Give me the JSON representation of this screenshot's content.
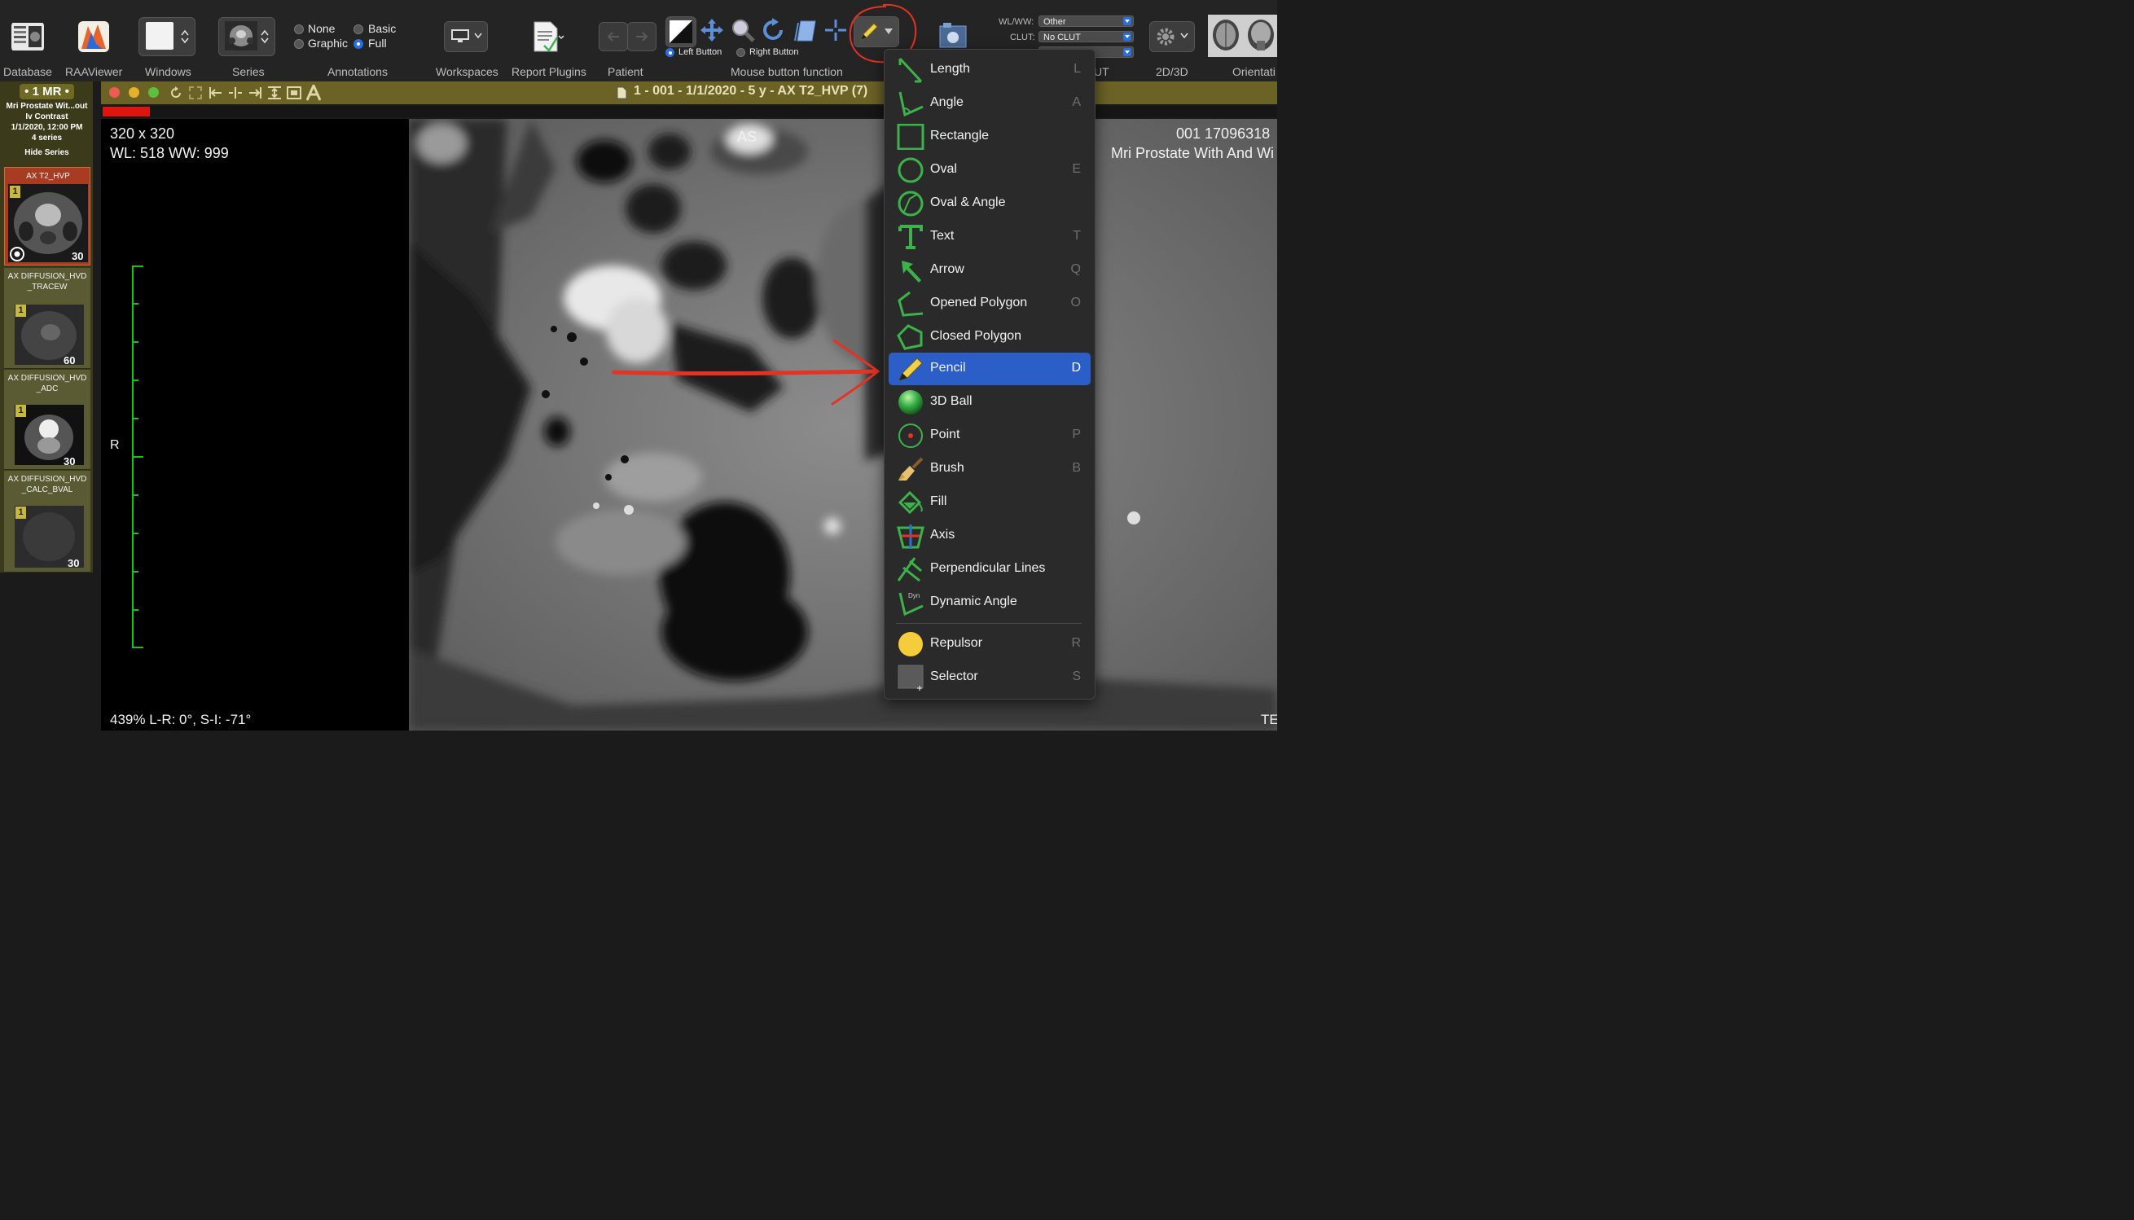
{
  "toolbar": {
    "labels": {
      "database": "Database",
      "raaviewer": "RAAViewer",
      "windows": "Windows",
      "series": "Series",
      "annotations": "Annotations",
      "workspaces": "Workspaces",
      "report_plugins": "Report Plugins",
      "patient": "Patient",
      "mouse_button_function": "Mouse button function",
      "lut_partial": "UT",
      "two_d_three_d": "2D/3D",
      "orientation_partial": "Orientati"
    },
    "annotations": {
      "none": "None",
      "basic": "Basic",
      "graphic": "Graphic",
      "full": "Full",
      "selected": "Full"
    },
    "mouse_buttons": {
      "left": "Left Button",
      "right": "Right Button",
      "selected": "Left Button"
    },
    "wlww": {
      "label": "WL/WW:",
      "value": "Other"
    },
    "clut": {
      "label": "CLUT:",
      "value": "No CLUT"
    }
  },
  "series_panel": {
    "study_label": "• 1 MR •",
    "study_name": "Mri Prostate Wit...out Iv Contrast",
    "study_date": "1/1/2020, 12:00 PM",
    "series_count": "4 series",
    "hide_series": "Hide Series",
    "series": [
      {
        "name": "AX T2_HVP",
        "badge": "1",
        "count": "30"
      },
      {
        "name": "AX DIFFUSION_HVD_TRACEW",
        "badge": "1",
        "count": "60"
      },
      {
        "name": "AX DIFFUSION_HVD_ADC",
        "badge": "1",
        "count": "30"
      },
      {
        "name": "AX DIFFUSION_HVD_CALC_BVAL",
        "badge": "1",
        "count": "30"
      }
    ]
  },
  "viewer": {
    "title": "1 - 001 - 1/1/2020 - 5 y - AX T2_HVP (7)",
    "matrix": "320 x 320",
    "wl_ww": "WL: 518 WW: 999",
    "orientation_top": "AS",
    "orientation_left": "R",
    "patient_id": "001 17096318",
    "study_desc": "Mri Prostate With And Wi",
    "zoom_info": "439% L-R: 0°, S-I: -71°",
    "bottom_right": "TE",
    "progress": 0.04
  },
  "tool_menu": {
    "items": [
      {
        "label": "Length",
        "key": "L",
        "icon": "length-icon"
      },
      {
        "label": "Angle",
        "key": "A",
        "icon": "angle-icon"
      },
      {
        "label": "Rectangle",
        "key": "",
        "icon": "rectangle-icon"
      },
      {
        "label": "Oval",
        "key": "E",
        "icon": "oval-icon"
      },
      {
        "label": "Oval & Angle",
        "key": "",
        "icon": "oval-angle-icon"
      },
      {
        "label": "Text",
        "key": "T",
        "icon": "text-icon"
      },
      {
        "label": "Arrow",
        "key": "Q",
        "icon": "arrow-icon"
      },
      {
        "label": "Opened Polygon",
        "key": "O",
        "icon": "opened-polygon-icon"
      },
      {
        "label": "Closed Polygon",
        "key": "",
        "icon": "closed-polygon-icon"
      },
      {
        "label": "Pencil",
        "key": "D",
        "icon": "pencil-icon"
      },
      {
        "label": "3D Ball",
        "key": "",
        "icon": "3d-ball-icon"
      },
      {
        "label": "Point",
        "key": "P",
        "icon": "point-icon"
      },
      {
        "label": "Brush",
        "key": "B",
        "icon": "brush-icon"
      },
      {
        "label": "Fill",
        "key": "",
        "icon": "fill-icon"
      },
      {
        "label": "Axis",
        "key": "",
        "icon": "axis-icon"
      },
      {
        "label": "Perpendicular Lines",
        "key": "",
        "icon": "perpendicular-lines-icon"
      },
      {
        "label": "Dynamic Angle",
        "key": "",
        "icon": "dynamic-angle-icon"
      },
      {
        "label": "Repulsor",
        "key": "R",
        "icon": "repulsor-icon"
      },
      {
        "label": "Selector",
        "key": "S",
        "icon": "selector-icon"
      }
    ],
    "selected": "Pencil",
    "dyn_glyph": "Dyn"
  },
  "colors": {
    "accent_blue": "#2b5fc7",
    "tool_green": "#3cb34a",
    "annotation_red": "#e53222",
    "scale_green": "#16c516",
    "viewer_bar": "#6b6226"
  }
}
